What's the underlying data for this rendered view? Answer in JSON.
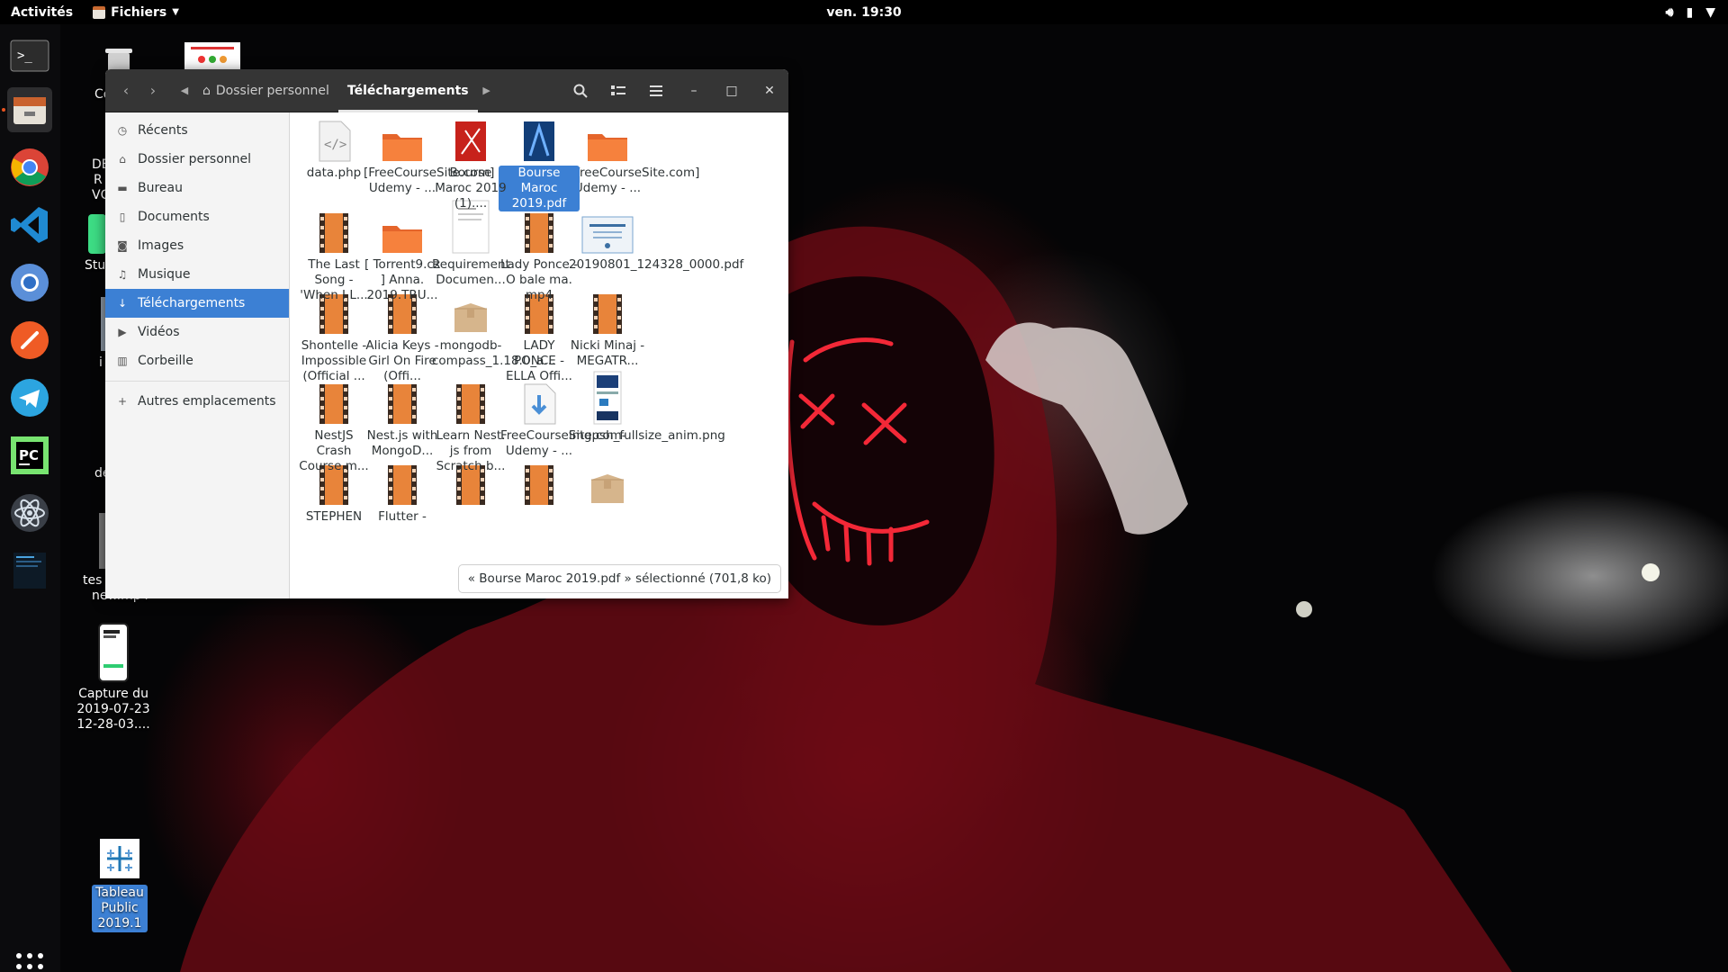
{
  "topbar": {
    "activities": "Activités",
    "app_menu": "Fichiers",
    "clock": "ven. 19:30"
  },
  "dock": {
    "items": [
      "terminal",
      "files",
      "chrome",
      "vscode",
      "chromium",
      "postman",
      "telegram",
      "pycharm",
      "atom",
      "screenshot-thumbnail"
    ]
  },
  "desktop": {
    "icons": [
      {
        "label": "Capture du 2019-07-23 12-28-03...."
      },
      {
        "label": "Tableau Public 2019.1"
      }
    ],
    "partial_labels": [
      "Co",
      "DE",
      "R",
      "VC",
      "Stu",
      "i",
      "de",
      "tes",
      "new.mp4"
    ]
  },
  "window": {
    "breadcrumb": {
      "home": "Dossier personnel",
      "current": "Téléchargements"
    },
    "sidebar": {
      "items": [
        {
          "label": "Récents",
          "icon": "clock-icon"
        },
        {
          "label": "Dossier personnel",
          "icon": "home-icon"
        },
        {
          "label": "Bureau",
          "icon": "folder-icon"
        },
        {
          "label": "Documents",
          "icon": "document-icon"
        },
        {
          "label": "Images",
          "icon": "camera-icon"
        },
        {
          "label": "Musique",
          "icon": "music-icon"
        },
        {
          "label": "Téléchargements",
          "icon": "download-icon",
          "selected": true
        },
        {
          "label": "Vidéos",
          "icon": "video-icon"
        },
        {
          "label": "Corbeille",
          "icon": "trash-icon"
        }
      ],
      "other_locations": "Autres emplacements"
    },
    "files": [
      {
        "name": "data.php",
        "kind": "code"
      },
      {
        "name": "[FreeCourseSite.com] Udemy - ...",
        "kind": "folder"
      },
      {
        "name": "Bourse Maroc 2019 (1)....",
        "kind": "pdf-red"
      },
      {
        "name": "Bourse Maroc 2019.pdf",
        "kind": "pdf-blue",
        "selected": true
      },
      {
        "name": "[FreeCourseSite.com] Udemy - ...",
        "kind": "folder"
      },
      {
        "name": "The Last Song - 'When I L...",
        "kind": "video"
      },
      {
        "name": "[ Torrent9.cz ] Anna. 2019.TRU...",
        "kind": "folder"
      },
      {
        "name": "Requirement Documen...",
        "kind": "doc"
      },
      {
        "name": "Lady Ponce - O bale ma. mp4",
        "kind": "video"
      },
      {
        "name": "20190801_124328_0000.pdf",
        "kind": "pdf-cert"
      },
      {
        "name": "Shontelle - Impossible (Official ...",
        "kind": "video"
      },
      {
        "name": "Alicia Keys - Girl On Fire (Offi...",
        "kind": "video"
      },
      {
        "name": "mongodb-compass_1.18.0_a...",
        "kind": "package"
      },
      {
        "name": "LADY PONCE - ELLA Offi...",
        "kind": "video"
      },
      {
        "name": "Nicki Minaj - MEGATR...",
        "kind": "video"
      },
      {
        "name": "NestJS Crash Course.m...",
        "kind": "video"
      },
      {
        "name": "Nest.js with MongoD...",
        "kind": "video"
      },
      {
        "name": "Learn Nest. js from Scratch b...",
        "kind": "video"
      },
      {
        "name": "FreeCourseSite.com- Udemy - ...",
        "kind": "download"
      },
      {
        "name": "imgpsh_fullsize_anim.png",
        "kind": "image"
      },
      {
        "name": "STEPHEN",
        "kind": "video"
      },
      {
        "name": "Flutter -",
        "kind": "video"
      },
      {
        "name": "",
        "kind": "video"
      },
      {
        "name": "",
        "kind": "video"
      },
      {
        "name": "",
        "kind": "package"
      }
    ],
    "status": "« Bourse Maroc 2019.pdf » sélectionné  (701,8 ko)"
  },
  "colors": {
    "selection": "#3c80d4",
    "headerbar": "#353535",
    "folder_orange": "#f47a3a",
    "accent_orange": "#e95420"
  }
}
